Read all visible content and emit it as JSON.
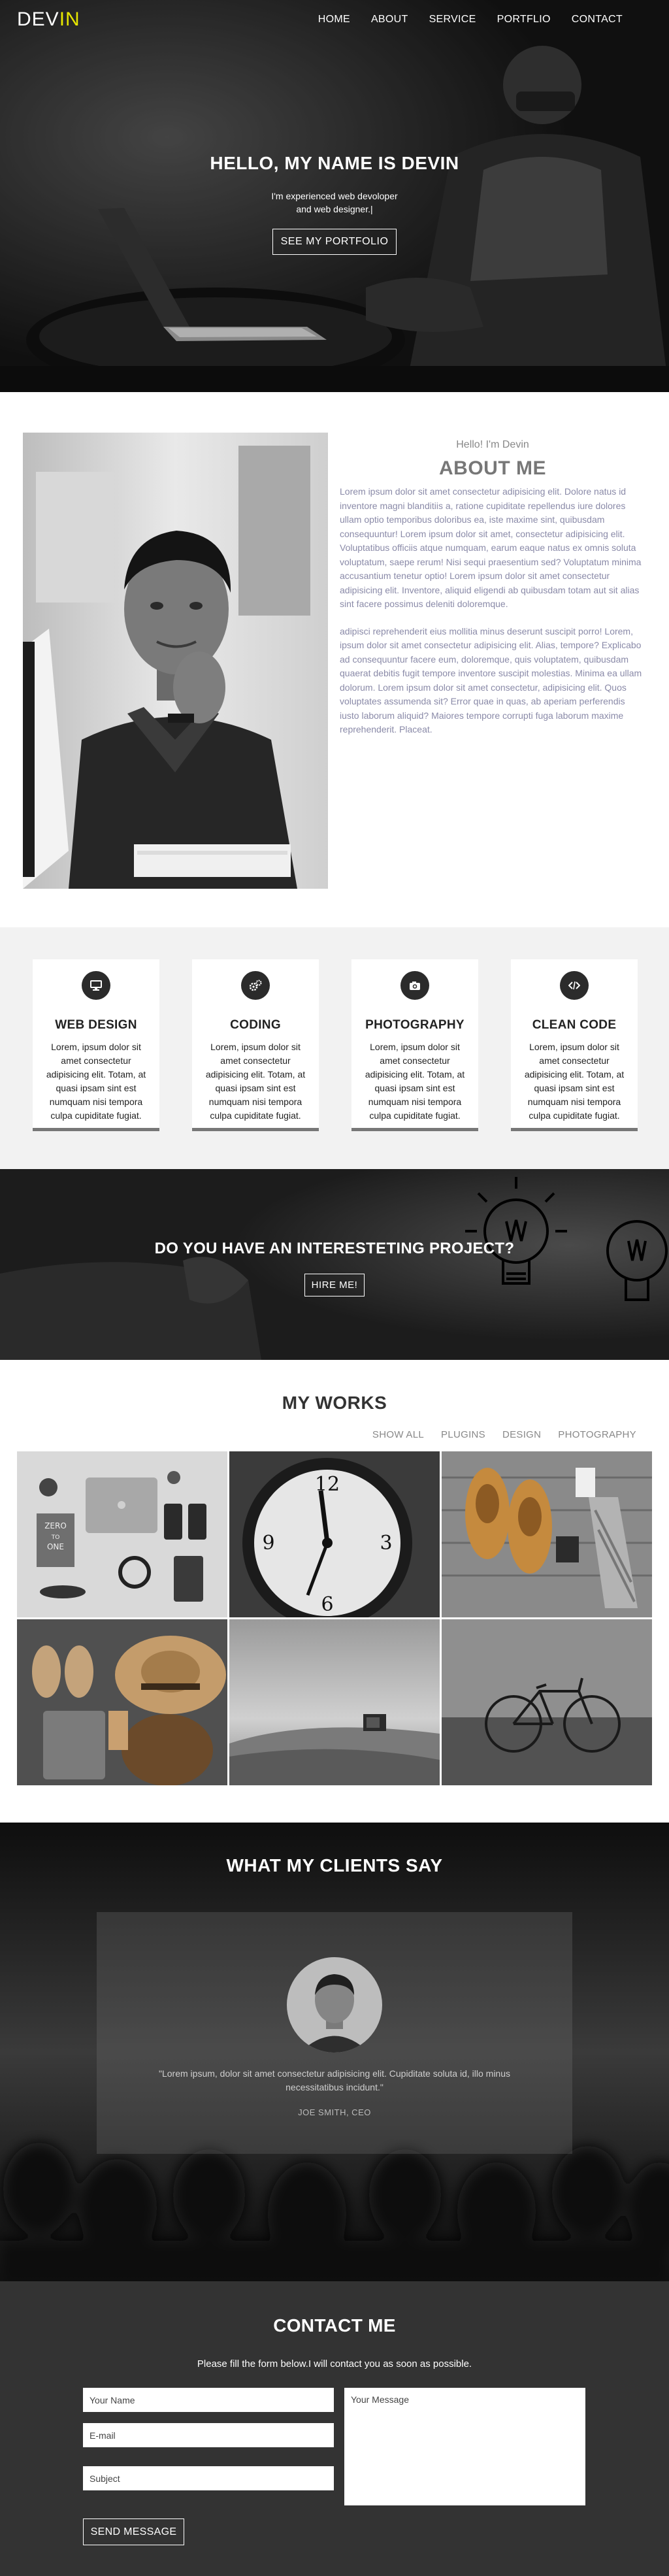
{
  "nav": {
    "logo_main": "DEV",
    "logo_accent": "IN",
    "items": [
      "HOME",
      "ABOUT",
      "SERVICE",
      "PORTFLIO",
      "CONTACT"
    ]
  },
  "hero": {
    "title": "HELLO, MY NAME IS DEVIN",
    "subtitle": "I'm experienced web devoloper\nand web designer.|",
    "button": "SEE MY PORTFOLIO"
  },
  "about": {
    "kicker": "Hello! I'm Devin",
    "title": "ABOUT ME",
    "paragraph1": "Lorem ipsum dolor sit amet consectetur adipisicing elit. Dolore natus id inventore magni blanditiis a, ratione cupiditate repellendus iure dolores ullam optio temporibus doloribus ea, iste maxime sint, quibusdam consequuntur! Lorem ipsum dolor sit amet, consectetur adipisicing elit. Voluptatibus officiis atque numquam, earum eaque natus ex omnis soluta voluptatum, saepe rerum! Nisi sequi praesentium sed? Voluptatum minima accusantium tenetur optio! Lorem ipsum dolor sit amet consectetur adipisicing elit. Inventore, aliquid eligendi ab quibusdam totam aut sit alias sint facere possimus deleniti doloremque.",
    "paragraph2": "adipisci reprehenderit eius mollitia minus deserunt suscipit porro! Lorem, ipsum dolor sit amet consectetur adipisicing elit. Alias, tempore? Explicabo ad consequuntur facere eum, doloremque, quis voluptatem, quibusdam quaerat debitis fugit tempore inventore suscipit molestias. Minima ea ullam dolorum. Lorem ipsum dolor sit amet consectetur, adipisicing elit. Quos voluptates assumenda sit? Error quae in quas, ab aperiam perferendis iusto laborum aliquid? Maiores tempore corrupti fuga laborum maxime reprehenderit. Placeat."
  },
  "services": [
    {
      "icon": "monitor-icon",
      "title": "WEB DESIGN",
      "desc": "Lorem, ipsum dolor sit amet consectetur adipisicing elit. Totam, at quasi ipsam sint est numquam nisi tempora culpa cupiditate fugiat."
    },
    {
      "icon": "gears-icon",
      "title": "CODING",
      "desc": "Lorem, ipsum dolor sit amet consectetur adipisicing elit. Totam, at quasi ipsam sint est numquam nisi tempora culpa cupiditate fugiat."
    },
    {
      "icon": "camera-icon",
      "title": "PHOTOGRAPHY",
      "desc": "Lorem, ipsum dolor sit amet consectetur adipisicing elit. Totam, at quasi ipsam sint est numquam nisi tempora culpa cupiditate fugiat."
    },
    {
      "icon": "code-icon",
      "title": "CLEAN CODE",
      "desc": "Lorem, ipsum dolor sit amet consectetur adipisicing elit. Totam, at quasi ipsam sint est numquam nisi tempora culpa cupiditate fugiat."
    }
  ],
  "cta": {
    "title": "DO YOU HAVE AN INTERESTETING PROJECT?",
    "button": "HIRE ME!"
  },
  "works": {
    "title": "MY WORKS",
    "filters": [
      "SHOW ALL",
      "PLUGINS",
      "DESIGN",
      "PHOTOGRAPHY"
    ],
    "book_title_lines": [
      "ZERO",
      "TO",
      "ONE"
    ]
  },
  "testimonial": {
    "title": "WHAT MY CLIENTS SAY",
    "quote": "\"Lorem ipsum, dolor sit amet consectetur adipisicing elit. Cupiditate soluta id, illo minus necessitatibus incidunt.\"",
    "author": "JOE SMITH, CEO"
  },
  "contact": {
    "title": "CONTACT ME",
    "subtitle": "Please fill the form below.I will contact you as soon as possible.",
    "name_placeholder": "Your Name",
    "email_placeholder": "E-mail",
    "subject_placeholder": "Subject",
    "message_placeholder": "Your Message",
    "send_button": "SEND MESSAGE"
  },
  "colors": {
    "logo_accent": "#e6e600",
    "about_text": "#8a8aa8",
    "services_bg": "#f2f2f2",
    "contact_bg": "#333333"
  }
}
